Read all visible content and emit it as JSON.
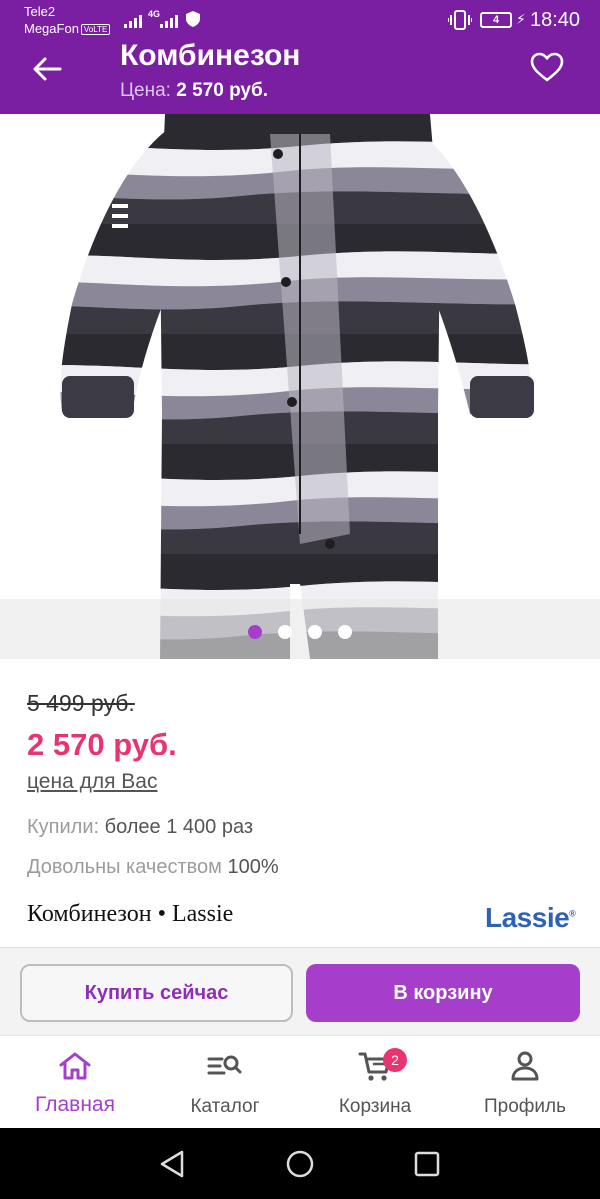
{
  "status_bar": {
    "carrier_1": "Tele2",
    "carrier_2": "MegaFon",
    "volte": "VoLTE",
    "network": "4G",
    "battery_level": "4",
    "time": "18:40"
  },
  "header": {
    "title": "Комбинезон",
    "price_label": "Цена:",
    "price_value": "2 570 руб.",
    "back_icon": "arrow-left-icon",
    "favorite_icon": "heart-outline-icon"
  },
  "gallery": {
    "image_count": 4,
    "active_index": 0
  },
  "product": {
    "old_price": "5 499 руб.",
    "new_price": "2 570 руб.",
    "price_for_you": "цена для Вас",
    "bought_label": "Купили:",
    "bought_value": "более 1 400 раз",
    "quality_label": "Довольны качеством",
    "quality_value": "100%",
    "name": "Комбинезон • Lassie",
    "brand": "Lassie"
  },
  "actions": {
    "buy_now": "Купить сейчас",
    "add_to_cart": "В корзину"
  },
  "bottom_nav": {
    "items": [
      {
        "label": "Главная",
        "icon": "home-icon",
        "active": true
      },
      {
        "label": "Каталог",
        "icon": "catalog-search-icon",
        "active": false
      },
      {
        "label": "Корзина",
        "icon": "cart-icon",
        "active": false,
        "badge": "2"
      },
      {
        "label": "Профиль",
        "icon": "profile-icon",
        "active": false
      }
    ]
  },
  "colors": {
    "primary": "#7b1fa2",
    "accent": "#a43ecb",
    "price": "#e8356f"
  }
}
